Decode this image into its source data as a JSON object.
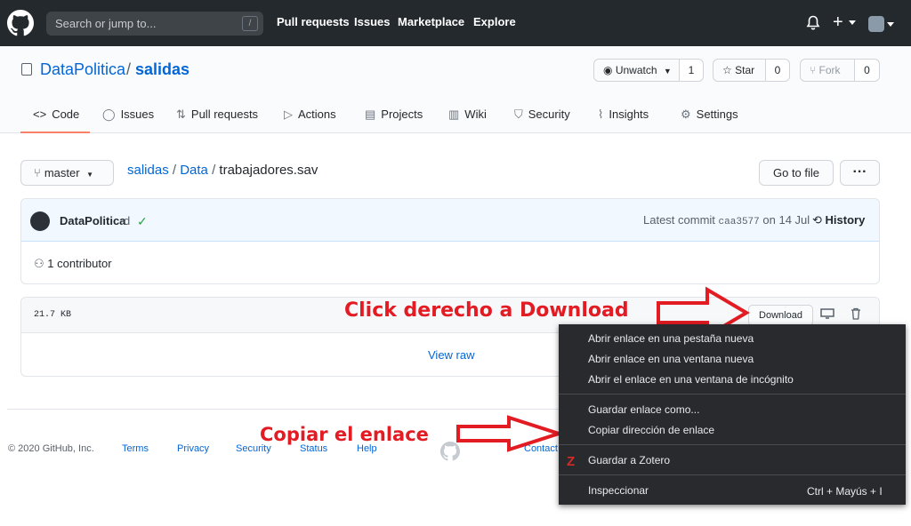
{
  "header": {
    "search_placeholder": "Search or jump to...",
    "search_shortcut": "/",
    "nav": [
      "Pull requests",
      "Issues",
      "Marketplace",
      "Explore"
    ],
    "plus": "+"
  },
  "repo": {
    "owner": "DataPolitica",
    "separator": "/",
    "name": "salidas",
    "watch_label": "Unwatch",
    "watch_count": "1",
    "star_label": "Star",
    "star_count": "0",
    "fork_label": "Fork",
    "fork_count": "0"
  },
  "tabs": [
    {
      "label": "Code",
      "icon": "code-icon"
    },
    {
      "label": "Issues",
      "icon": "issue-icon"
    },
    {
      "label": "Pull requests",
      "icon": "pull-request-icon"
    },
    {
      "label": "Actions",
      "icon": "play-icon"
    },
    {
      "label": "Projects",
      "icon": "project-icon"
    },
    {
      "label": "Wiki",
      "icon": "book-icon"
    },
    {
      "label": "Security",
      "icon": "shield-icon"
    },
    {
      "label": "Insights",
      "icon": "graph-icon"
    },
    {
      "label": "Settings",
      "icon": "gear-icon"
    }
  ],
  "file_nav": {
    "branch": "master",
    "crumbs": [
      "salidas",
      "Data",
      "trabajadores.sav"
    ],
    "go_to_file": "Go to file",
    "more": "···"
  },
  "commit": {
    "author": "DataPolitica",
    "message": "d",
    "latest_prefix": "Latest commit",
    "sha": "caa3577",
    "date": "on 14 Jul",
    "history": "History",
    "contributors": "1 contributor"
  },
  "file": {
    "size": "21.7 KB",
    "download": "Download",
    "view_raw": "View raw"
  },
  "footer": {
    "copyright": "© 2020 GitHub, Inc.",
    "links": [
      "Terms",
      "Privacy",
      "Security",
      "Status",
      "Help",
      "Contact"
    ]
  },
  "annotations": {
    "download_hint": "Click derecho a Download",
    "copy_hint": "Copiar el enlace"
  },
  "context_menu": {
    "items": [
      "Abrir enlace en una pestaña nueva",
      "Abrir enlace en una ventana nueva",
      "Abrir el enlace en una ventana de incógnito",
      "Guardar enlace como...",
      "Copiar dirección de enlace",
      "Guardar a Zotero",
      "Inspeccionar"
    ],
    "inspect_shortcut": "Ctrl + Mayús + I",
    "zotero_icon": "Z"
  },
  "colors": {
    "header_bg": "#24292e",
    "link": "#0366d6",
    "tab_accent": "#f9826c",
    "annotation": "#e31b23",
    "menu_bg": "#292a2d"
  }
}
